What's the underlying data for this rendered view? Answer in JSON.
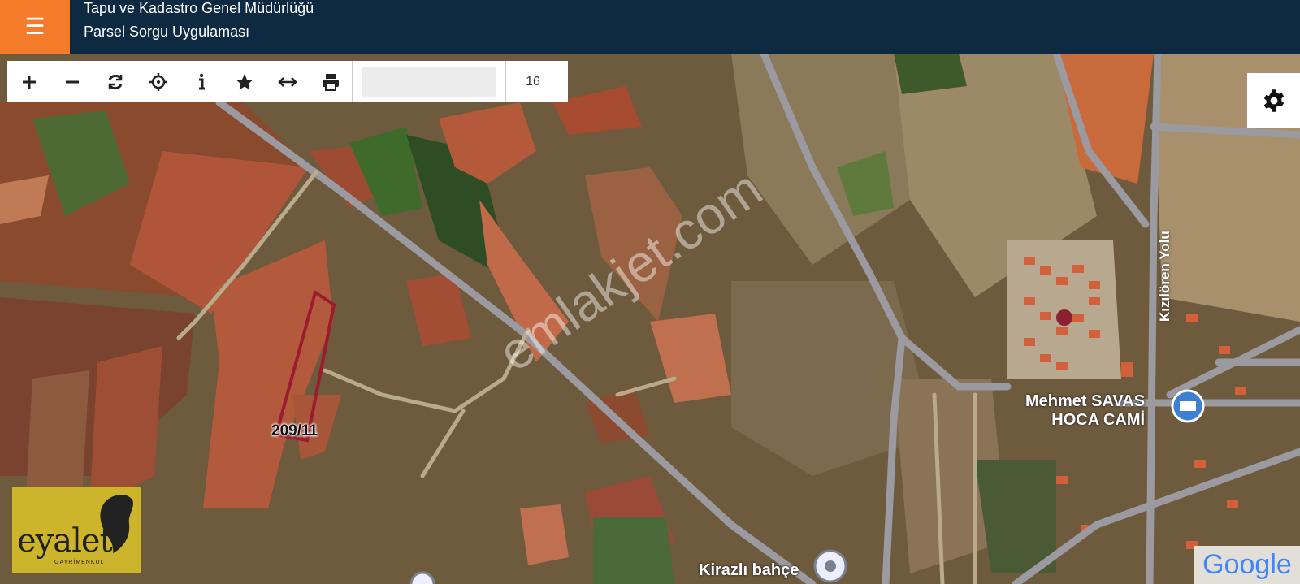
{
  "header": {
    "org_name": "Tapu ve Kadastro Genel Müdürlüğü",
    "app_name": "Parsel Sorgu Uygulaması",
    "menu_icon": "hamburger-icon",
    "menu_glyph": "☰"
  },
  "toolbar": {
    "tools": [
      {
        "name": "zoom-in",
        "icon": "plus-icon"
      },
      {
        "name": "zoom-out",
        "icon": "minus-icon"
      },
      {
        "name": "refresh",
        "icon": "refresh-icon"
      },
      {
        "name": "locate",
        "icon": "crosshair-icon"
      },
      {
        "name": "info",
        "icon": "info-icon"
      },
      {
        "name": "favorite",
        "icon": "star-icon"
      },
      {
        "name": "measure",
        "icon": "arrows-horizontal-icon"
      },
      {
        "name": "print",
        "icon": "printer-icon"
      }
    ],
    "search_value": "",
    "zoom_level": "16"
  },
  "settings": {
    "icon": "gear-icon"
  },
  "map": {
    "parcel_label": "209/11",
    "parcel_color": "#9c1b2e",
    "poi_name": "Mehmet SAVAS HOCA CAMİ",
    "poi_line1": "Mehmet SAVAS",
    "poi_line2": "HOCA CAMİ",
    "road_label": "Kızılören Yolu",
    "bottom_label": "Kirazlı bahçe",
    "watermark": "emlakjet.com"
  },
  "branding": {
    "logo_word": "eyalet",
    "logo_sub": "GAYRİMENKUL",
    "logo_color": "#cdb52b",
    "google_word": "Google"
  }
}
